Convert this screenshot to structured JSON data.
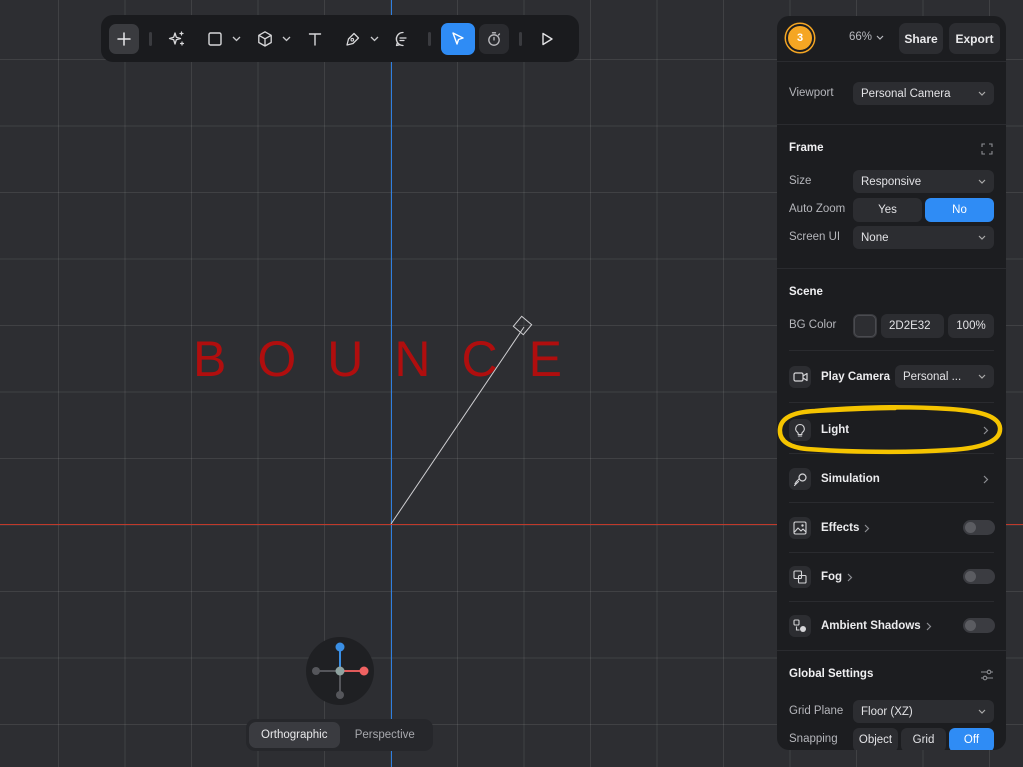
{
  "scene": {
    "text": "BOUNCE"
  },
  "toolbar": {
    "tools": [
      "plus-icon",
      "ai-sparkle-icon",
      "rectangle-icon",
      "cube-icon",
      "text-icon",
      "pen-icon",
      "comment-icon",
      "pointer-icon",
      "timer-icon",
      "play-icon"
    ]
  },
  "view_toggle": {
    "ortho": "Orthographic",
    "persp": "Perspective",
    "selected": "Orthographic"
  },
  "panel": {
    "avatar": "3",
    "zoom": "66%",
    "share": "Share",
    "export": "Export",
    "viewport_label": "Viewport",
    "viewport_value": "Personal Camera",
    "frame": {
      "title": "Frame",
      "size_label": "Size",
      "size_value": "Responsive",
      "autozoom_label": "Auto Zoom",
      "yes": "Yes",
      "no": "No",
      "autozoom_selected": "No",
      "screenui_label": "Screen UI",
      "screenui_value": "None"
    },
    "scene": {
      "title": "Scene",
      "bg_label": "BG Color",
      "bg_hex": "2D2E32",
      "bg_opacity": "100%",
      "bg_color": "#2D2E32",
      "play_camera_label": "Play Camera",
      "play_camera_value": "Personal ...",
      "light": "Light",
      "simulation": "Simulation",
      "effects": "Effects",
      "fog": "Fog",
      "ambient": "Ambient Shadows"
    },
    "global": {
      "title": "Global Settings",
      "grid_plane_label": "Grid Plane",
      "grid_plane_value": "Floor (XZ)",
      "snapping_label": "Snapping",
      "object": "Object",
      "grid": "Grid",
      "off": "Off",
      "snapping_selected": "Off"
    }
  },
  "colors": {
    "accent": "#2f8cf5",
    "highlight": "#f5c400",
    "text_red": "#b00e0e"
  }
}
